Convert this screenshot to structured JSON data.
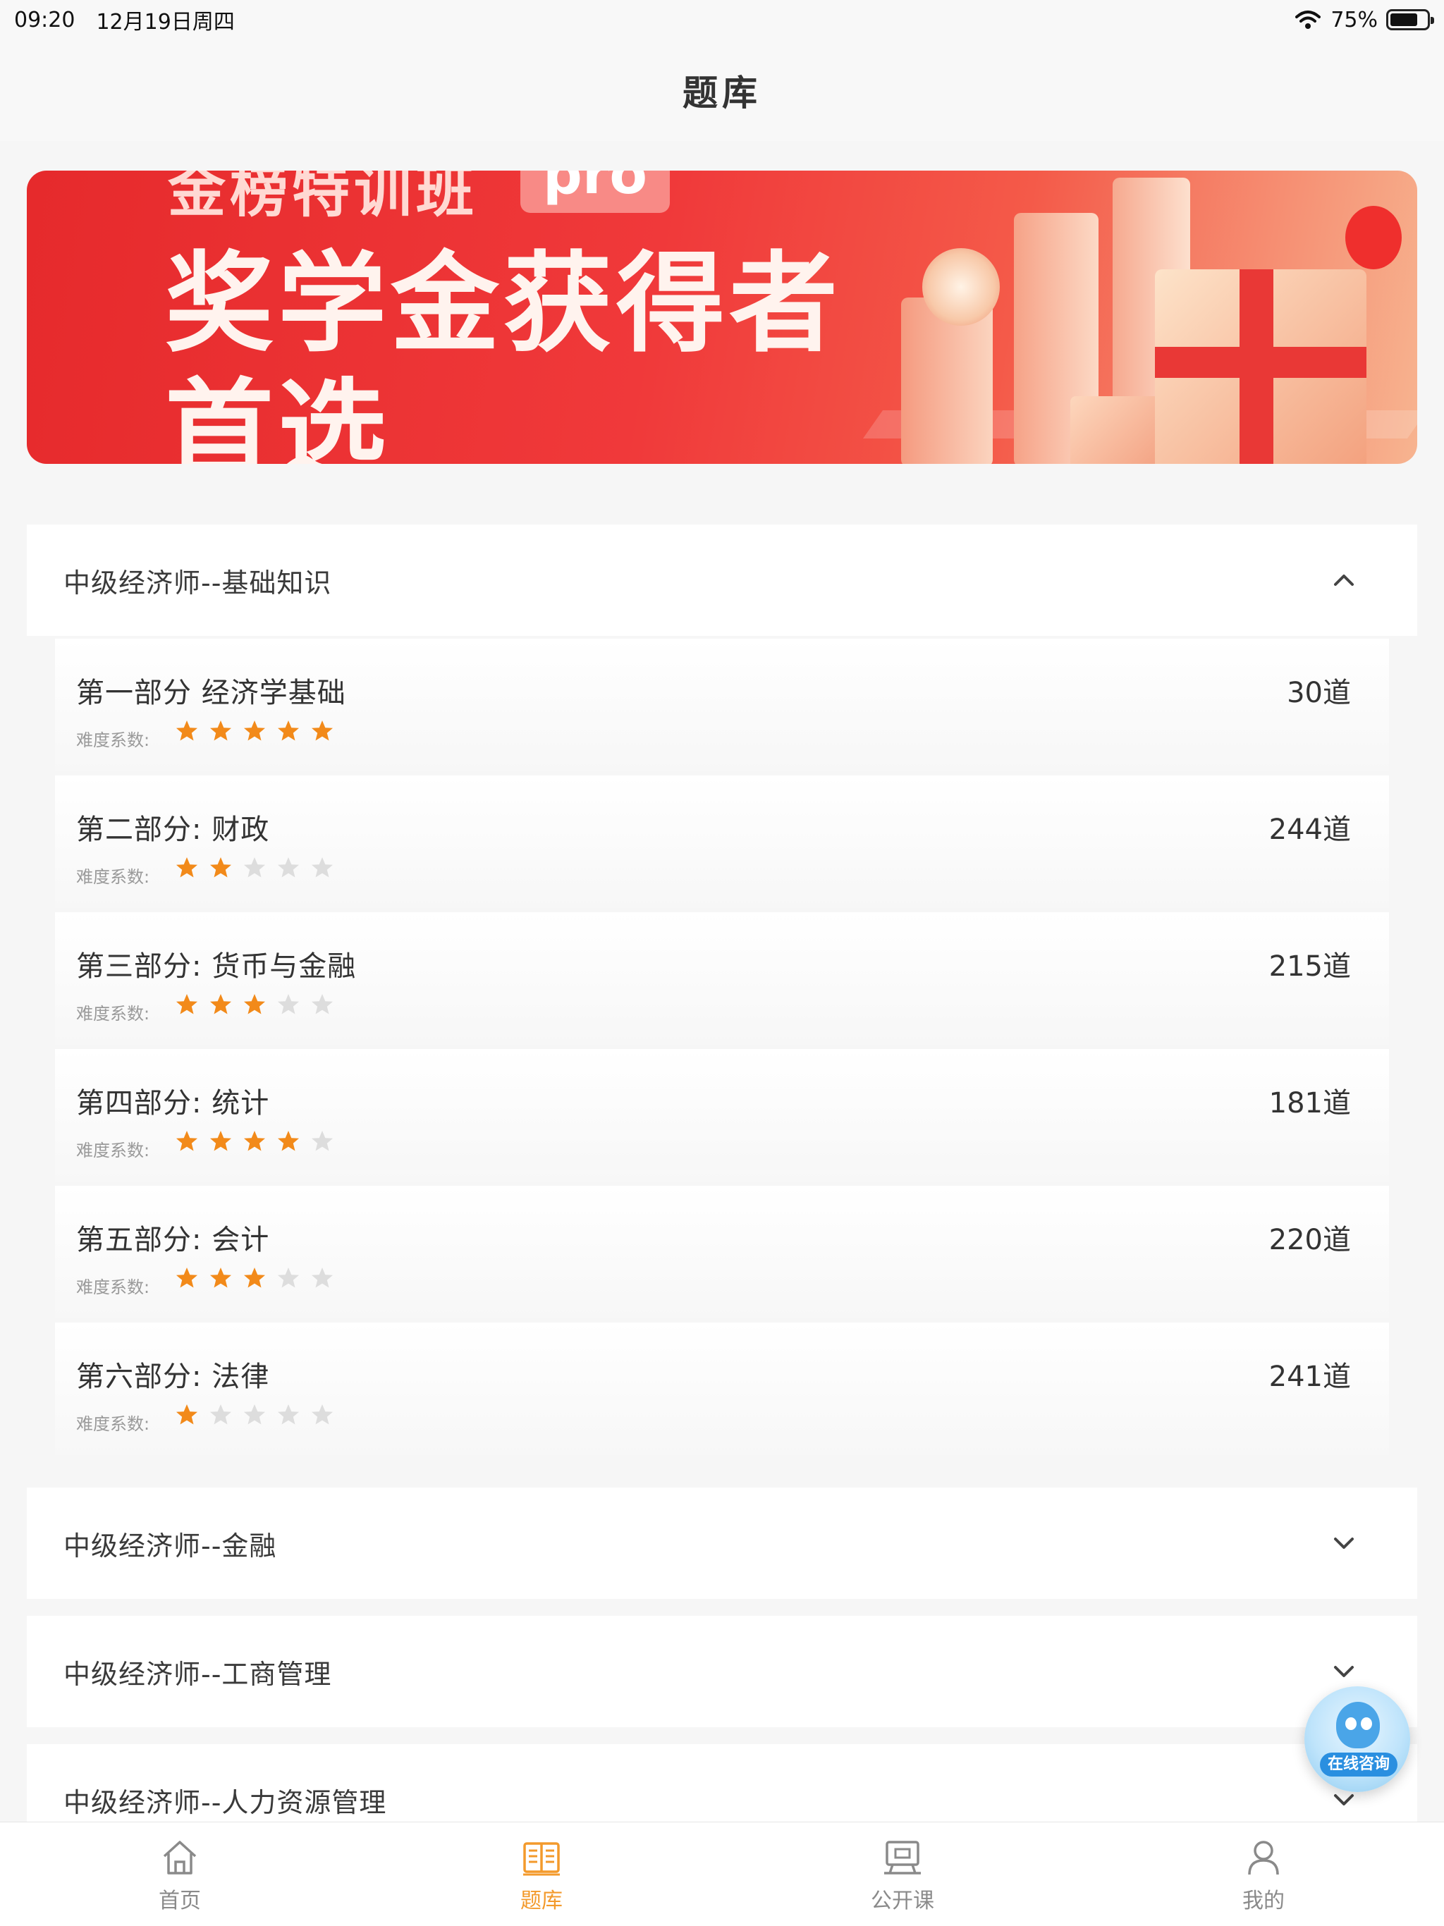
{
  "status_bar": {
    "time": "09:20",
    "date": "12月19日周四",
    "battery": "75%",
    "battery_level": 0.75
  },
  "header": {
    "title": "题库"
  },
  "banner": {
    "top_text": "金榜特训班",
    "tag": "pro",
    "headline_1": "奖学金获得者",
    "headline_2": "首选"
  },
  "sections": [
    {
      "title": "中级经济师--基础知识",
      "expanded": true,
      "items": [
        {
          "name": "第一部分 经济学基础",
          "count": "30道",
          "difficulty_label": "难度系数:",
          "stars": 5
        },
        {
          "name": "第二部分: 财政",
          "count": "244道",
          "difficulty_label": "难度系数:",
          "stars": 2
        },
        {
          "name": "第三部分: 货币与金融",
          "count": "215道",
          "difficulty_label": "难度系数:",
          "stars": 3
        },
        {
          "name": "第四部分: 统计",
          "count": "181道",
          "difficulty_label": "难度系数:",
          "stars": 4
        },
        {
          "name": "第五部分: 会计",
          "count": "220道",
          "difficulty_label": "难度系数:",
          "stars": 3
        },
        {
          "name": "第六部分: 法律",
          "count": "241道",
          "difficulty_label": "难度系数:",
          "stars": 1
        }
      ]
    },
    {
      "title": "中级经济师--金融",
      "expanded": false
    },
    {
      "title": "中级经济师--工商管理",
      "expanded": false
    },
    {
      "title": "中级经济师--人力资源管理",
      "expanded": false
    }
  ],
  "consult": {
    "label": "在线咨询"
  },
  "tabs": [
    {
      "label": "首页",
      "icon": "home-icon",
      "active": false
    },
    {
      "label": "题库",
      "icon": "book-icon",
      "active": true
    },
    {
      "label": "公开课",
      "icon": "screen-icon",
      "active": false
    },
    {
      "label": "我的",
      "icon": "user-icon",
      "active": false
    }
  ],
  "colors": {
    "accent": "#f39a2c",
    "star_on": "#f28a1a",
    "star_off": "#dddddd",
    "banner_red": "#e62a2c"
  }
}
